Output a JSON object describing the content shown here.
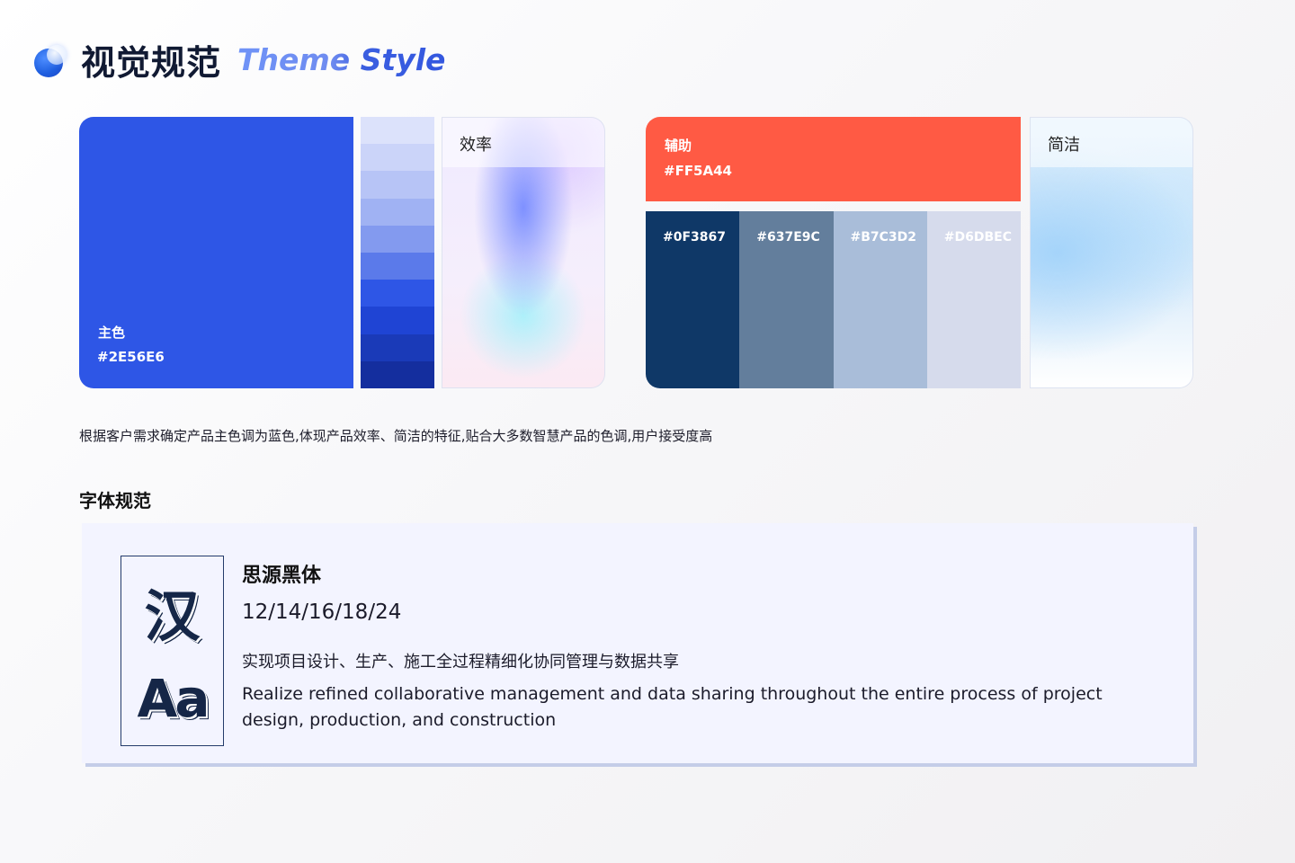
{
  "header": {
    "title_cn": "视觉规范",
    "title_en": "Theme Style",
    "icon": "bubble-logo-icon"
  },
  "primary": {
    "label": "主色",
    "hex": "#2E56E6",
    "color": "#2E56E6",
    "steps": [
      "#DCE2FB",
      "#CBD4F9",
      "#B7C4F6",
      "#A0B2F3",
      "#839AEF",
      "#5B7AEA",
      "#2E56E6",
      "#1F44D4",
      "#1A3AB8",
      "#142E9E"
    ]
  },
  "efficiency_card": {
    "title": "效率"
  },
  "auxiliary": {
    "label": "辅助",
    "hex": "#FF5A44",
    "color": "#FF5A44"
  },
  "swatches": [
    {
      "hex": "#0F3867",
      "color": "#0F3867"
    },
    {
      "hex": "#637E9C",
      "color": "#637E9C"
    },
    {
      "hex": "#B7C3D2",
      "color": "#A9BDD9"
    },
    {
      "hex": "#D6DBEC",
      "color": "#D6DBEC"
    }
  ],
  "simple_card": {
    "title": "简洁"
  },
  "description": "根据客户需求确定产品主色调为蓝色,体现产品效率、简洁的特征,贴合大多数智慧产品的色调,用户接受度高",
  "font_spec": {
    "section_title": "字体规范",
    "glyph_cn": "汉",
    "glyph_en": "Aa",
    "font_name": "思源黑体",
    "sizes": "12/14/16/18/24",
    "sample_cn": "实现项目设计、生产、施工全过程精细化协同管理与数据共享",
    "sample_en": "Realize refined collaborative management and data sharing throughout the entire process of project design, production, and construction"
  }
}
